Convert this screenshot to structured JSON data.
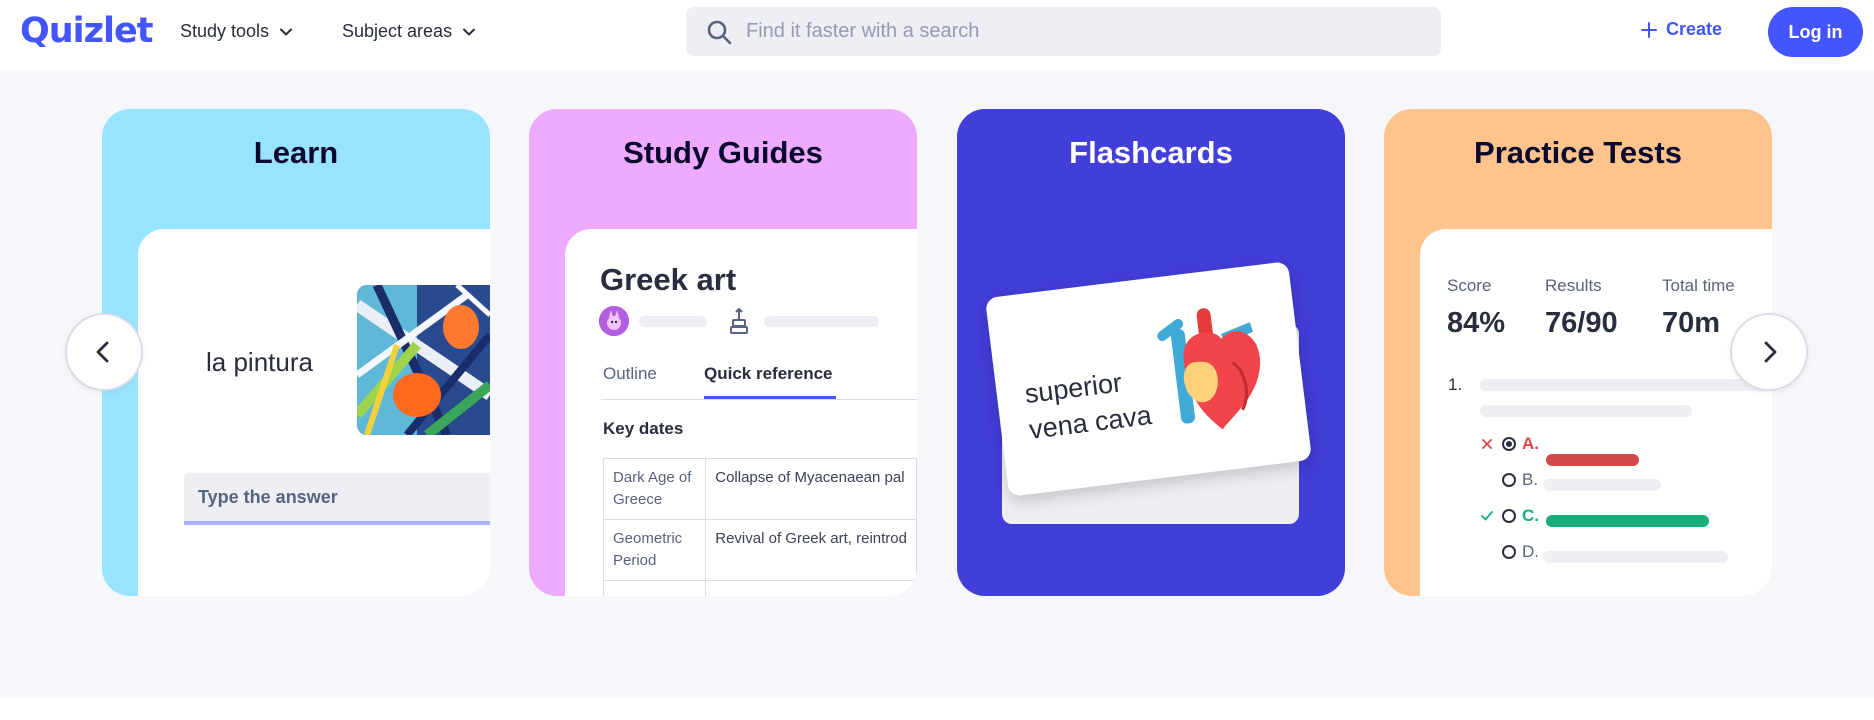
{
  "header": {
    "logo": "Quizlet",
    "nav": [
      {
        "label": "Study tools"
      },
      {
        "label": "Subject areas"
      }
    ],
    "search": {
      "placeholder": "Find it faster with a search",
      "value": ""
    },
    "create_label": "Create",
    "login_label": "Log in"
  },
  "cards": {
    "learn": {
      "title": "Learn",
      "term": "la pintura",
      "answer_placeholder": "Type the answer"
    },
    "study_guides": {
      "title": "Study Guides",
      "guide_title": "Greek art",
      "tabs": [
        "Outline",
        "Quick reference"
      ],
      "active_tab": "Quick reference",
      "section_title": "Key dates",
      "rows": [
        {
          "period": "Dark Age of Greece",
          "event": "Collapse of Myacenaean pal"
        },
        {
          "period": "Geometric Period",
          "event": "Revival of Greek art, reintrod"
        }
      ]
    },
    "flashcards": {
      "title": "Flashcards",
      "card_text_line1": "superior",
      "card_text_line2": "vena cava"
    },
    "practice_tests": {
      "title": "Practice Tests",
      "stats": [
        {
          "label": "Score",
          "value": "84%"
        },
        {
          "label": "Results",
          "value": "76/90"
        },
        {
          "label": "Total time",
          "value": "70m"
        }
      ],
      "question_number": "1.",
      "options": [
        {
          "letter": "A.",
          "status": "wrong",
          "selected": true
        },
        {
          "letter": "B.",
          "status": "neutral",
          "selected": false
        },
        {
          "letter": "C.",
          "status": "correct",
          "selected": false
        },
        {
          "letter": "D.",
          "status": "neutral",
          "selected": false
        }
      ]
    }
  },
  "colors": {
    "brand": "#4255ff",
    "learn_bg": "#98e3ff",
    "guides_bg": "#eeaaff",
    "flash_bg": "#423ed8",
    "practice_bg": "#ffc38c",
    "wrong": "#d44a4a",
    "correct": "#18ae79"
  },
  "icons": [
    "search-icon",
    "chevron-down-icon",
    "plus-icon",
    "chevron-left-icon",
    "chevron-right-icon",
    "stack-icon",
    "heart-illustration"
  ]
}
